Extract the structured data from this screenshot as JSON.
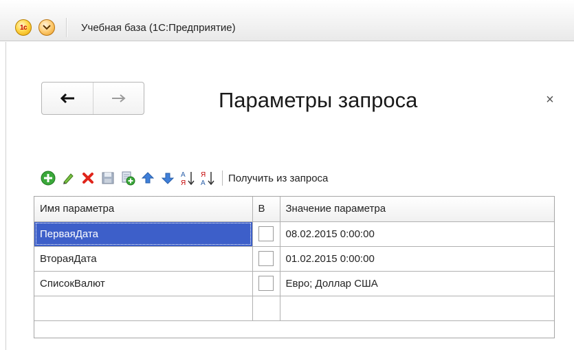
{
  "window": {
    "title": "Учебная база  (1С:Предприятие)",
    "logo_text": "1c"
  },
  "form": {
    "title": "Параметры запроса",
    "close_glyph": "×"
  },
  "toolbar": {
    "icons": [
      "add-icon",
      "edit-pencil-icon",
      "delete-icon",
      "save-icon",
      "copy-icon",
      "move-up-icon",
      "move-down-icon",
      "sort-ascending-icon",
      "sort-descending-icon"
    ],
    "fetch_label": "Получить из запроса"
  },
  "grid": {
    "columns": [
      "Имя параметра",
      "В",
      "Значение параметра"
    ],
    "rows": [
      {
        "name": "ПерваяДата",
        "checked": false,
        "value": "08.02.2015 0:00:00",
        "selected": true
      },
      {
        "name": "ВтораяДата",
        "checked": false,
        "value": "01.02.2015 0:00:00",
        "selected": false
      },
      {
        "name": "СписокВалют",
        "checked": false,
        "value": "Евро; Доллар США",
        "selected": false
      }
    ]
  },
  "colors": {
    "selection": "#3d5fc9",
    "add_green": "#3aa83a",
    "delete_red": "#e0251b",
    "arrow_blue": "#3f7fd9"
  }
}
